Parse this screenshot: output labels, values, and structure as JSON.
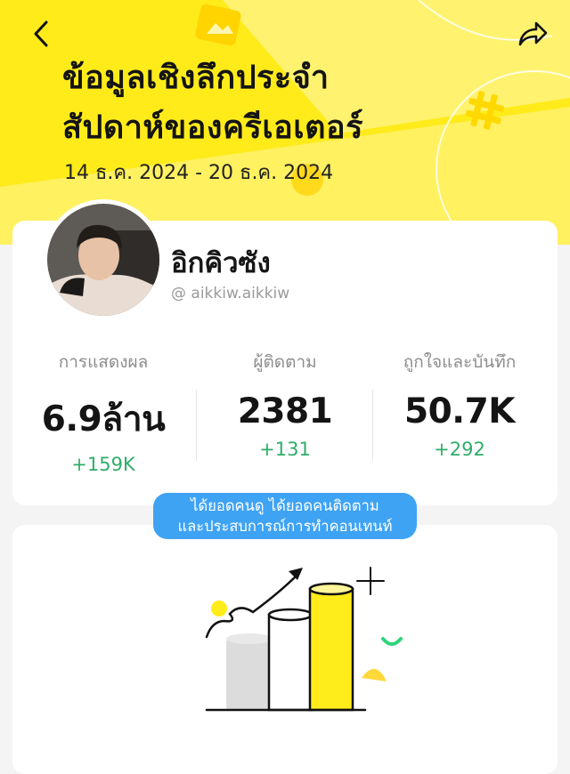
{
  "header": {
    "title_line1": "ข้อมูลเชิงลึกประจำ",
    "title_line2": "สัปดาห์ของครีเอเตอร์",
    "date_range": "14 ธ.ค. 2024 - 20 ธ.ค. 2024",
    "back_icon": "chevron-left-icon",
    "share_icon": "share-arrow-icon",
    "background_color": "#ffeb1a"
  },
  "profile": {
    "name": "อิกคิวซัง",
    "handle": "@ aikkiw.aikkiw"
  },
  "stats": [
    {
      "label": "การแสดงผล",
      "value": "6.9ล้าน",
      "delta": "+159K"
    },
    {
      "label": "ผู้ติดตาม",
      "value": "2381",
      "delta": "+131"
    },
    {
      "label": "ถูกใจและบันทึก",
      "value": "50.7K",
      "delta": "+292"
    }
  ],
  "tooltip": {
    "line1": "ได้ยอดคนดู ได้ยอดคนติดตาม",
    "line2": "และประสบการณ์การทำคอนเทนท์"
  },
  "colors": {
    "accent_yellow": "#ffeb1a",
    "positive_green": "#2fad6a",
    "tooltip_blue": "#3fa3f4"
  }
}
